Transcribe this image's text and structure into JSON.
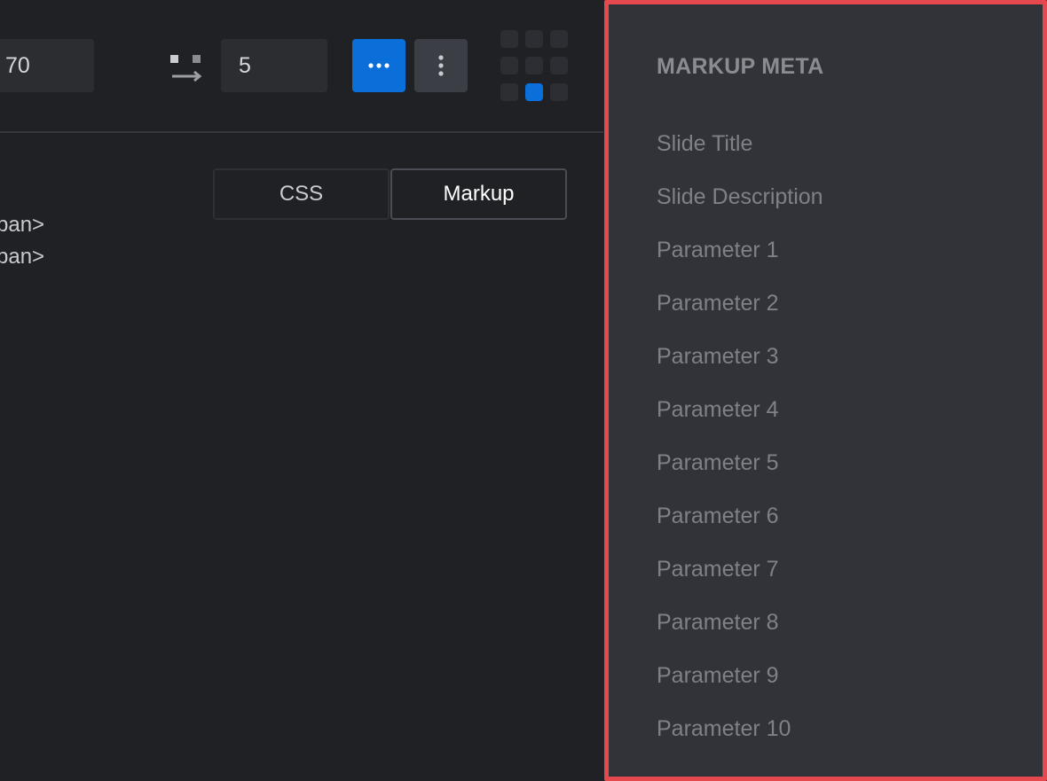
{
  "toolbar": {
    "first_input_value": "70",
    "second_input_value": "5",
    "more_button_icon": "ellipsis-horizontal-icon",
    "kebab_button_icon": "ellipsis-vertical-icon",
    "gap_icon": "horizontal-gap-icon",
    "accent_color": "#0b6fd9"
  },
  "tabs": [
    {
      "label": "CSS",
      "active": false
    },
    {
      "label": "Markup",
      "active": true
    }
  ],
  "code": {
    "lines": [
      "pan>",
      "pan>"
    ]
  },
  "meta": {
    "title": "MARKUP META",
    "items": [
      "Slide Title",
      "Slide Description",
      "Parameter 1",
      "Parameter 2",
      "Parameter 3",
      "Parameter 4",
      "Parameter 5",
      "Parameter 6",
      "Parameter 7",
      "Parameter 8",
      "Parameter 9",
      "Parameter 10"
    ],
    "highlight_color": "#e5484d"
  }
}
